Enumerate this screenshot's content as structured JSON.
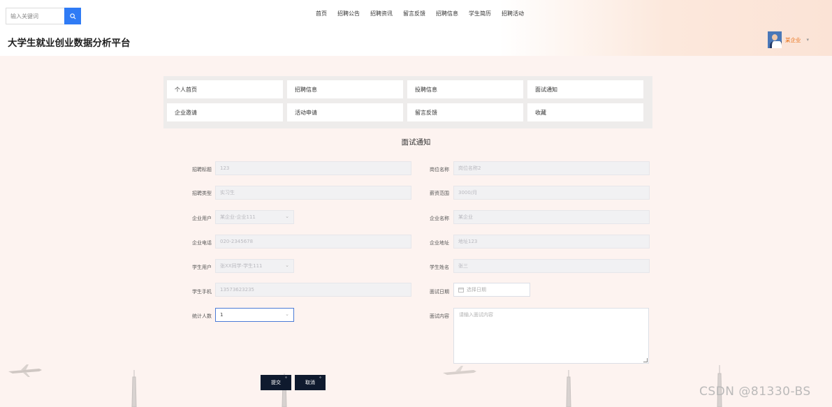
{
  "search": {
    "placeholder": "输入关键词"
  },
  "nav": [
    "首页",
    "招聘公告",
    "招聘资讯",
    "留言反馈",
    "招聘信息",
    "学生简历",
    "招聘活动"
  ],
  "app": {
    "title": "大学生就业创业数据分析平台"
  },
  "user": {
    "name": "某企业"
  },
  "menu": [
    "个人首页",
    "招聘信息",
    "投聘信息",
    "面试通知",
    "企业邀请",
    "活动申请",
    "留言反馈",
    "收藏"
  ],
  "form": {
    "title": "面试通知",
    "left": [
      {
        "label": "招聘标题",
        "value": "123"
      },
      {
        "label": "招聘类型",
        "value": "实习生"
      },
      {
        "label": "企业用户",
        "value": "某企业-企业111"
      },
      {
        "label": "企业电话",
        "value": "020-2345678"
      },
      {
        "label": "学生用户",
        "value": "张XX同学-学生111"
      },
      {
        "label": "学生手机",
        "value": "13573623235"
      },
      {
        "label": "统计人数",
        "value": "1"
      }
    ],
    "right": [
      {
        "label": "岗位名称",
        "value": "岗位名称2"
      },
      {
        "label": "薪资范围",
        "value": "3000/月"
      },
      {
        "label": "企业名称",
        "value": "某企业"
      },
      {
        "label": "企业地址",
        "value": "地址123"
      },
      {
        "label": "学生姓名",
        "value": "张三"
      },
      {
        "label": "面试日期",
        "value": "选择日期"
      },
      {
        "label": "面试内容",
        "value": "请输入面试内容"
      }
    ]
  },
  "buttons": {
    "submit": "提交",
    "cancel": "取消"
  },
  "watermark": "CSDN @81330-BS",
  "colors": {
    "accent": "#2f7bf5",
    "user_name": "#e8731d",
    "button_dark": "#0f1a2e"
  }
}
